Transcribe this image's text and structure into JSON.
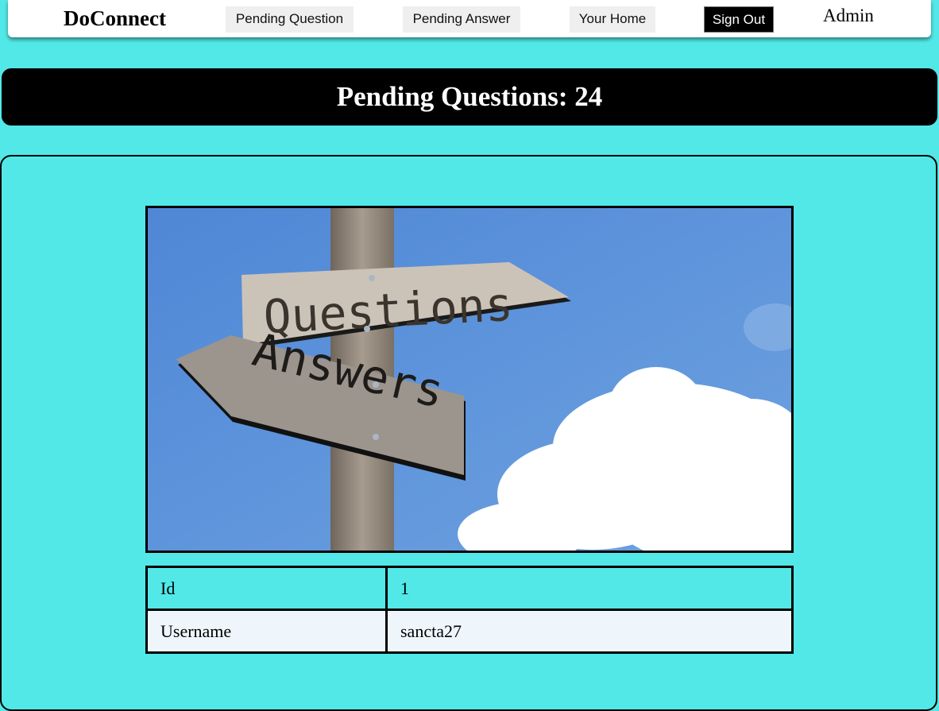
{
  "navbar": {
    "brand": "DoConnect",
    "links": {
      "pending_question": "Pending Question",
      "pending_answer": "Pending Answer",
      "your_home": "Your Home",
      "sign_out": "Sign Out"
    },
    "user_role": "Admin"
  },
  "header": {
    "title": "Pending Questions: 24"
  },
  "hero_image": {
    "sign_top": "Questions",
    "sign_bottom": "Answers"
  },
  "question_details": {
    "rows": [
      {
        "label": "Id",
        "value": "1"
      },
      {
        "label": "Username",
        "value": "sancta27"
      }
    ]
  },
  "colors": {
    "background": "#52e8e8",
    "header": "#000000",
    "sign_out_button": "#000000"
  }
}
